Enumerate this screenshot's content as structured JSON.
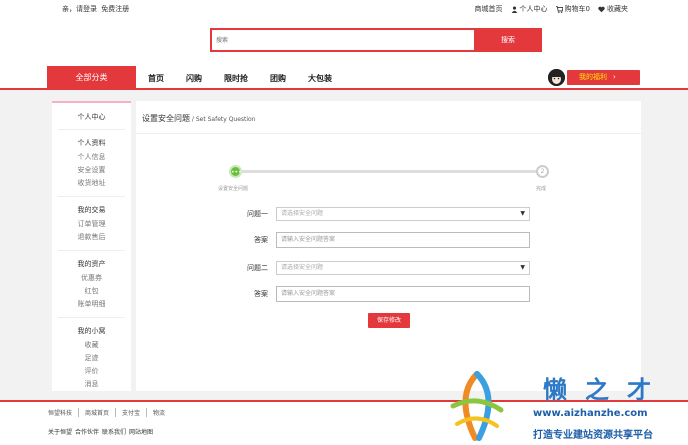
{
  "topbar": {
    "greeting": "亲，请登录",
    "register": "免费注册",
    "links": [
      {
        "label": "商城首页",
        "icon": ""
      },
      {
        "label": "个人中心",
        "icon": "user-icon"
      },
      {
        "label": "购物车0",
        "icon": "cart-icon"
      },
      {
        "label": "收藏夹",
        "icon": "heart-icon"
      }
    ]
  },
  "search": {
    "placeholder": "搜索",
    "button": "搜索"
  },
  "nav": {
    "all_category": "全部分类",
    "menu": [
      "首页",
      "闪购",
      "限时抢",
      "团购",
      "大包装"
    ],
    "welfare": "我的福利",
    "welfare_arrow": "›"
  },
  "sidebar": {
    "title": "个人中心",
    "groups": [
      {
        "header": "个人资料",
        "items": [
          "个人信息",
          "安全设置",
          "收货地址"
        ]
      },
      {
        "header": "我的交易",
        "items": [
          "订单管理",
          "退款售后"
        ]
      },
      {
        "header": "我的资产",
        "items": [
          "优惠券",
          "红包",
          "账单明细"
        ]
      },
      {
        "header": "我的小窝",
        "items": [
          "收藏",
          "足迹",
          "评价",
          "消息"
        ]
      }
    ]
  },
  "main": {
    "title": "设置安全问题",
    "title_en": " / Set Safety Question",
    "steps": [
      {
        "label": "设置安全问题",
        "marker": "•••"
      },
      {
        "label": "完成",
        "marker": "2"
      }
    ],
    "rows": [
      {
        "label": "问题一",
        "type": "select",
        "placeholder": "请选择安全问题"
      },
      {
        "label": "答案",
        "type": "input",
        "placeholder": "请输入安全问题答案"
      },
      {
        "label": "问题二",
        "type": "select",
        "placeholder": "请选择安全问题"
      },
      {
        "label": "答案",
        "type": "input",
        "placeholder": "请输入安全问题答案"
      }
    ],
    "save_button": "保存修改"
  },
  "footer": {
    "links": [
      "恒望科技",
      "商城首页",
      "支付宝",
      "物流"
    ],
    "sub": [
      "关于恒望",
      "合作伙伴",
      "联系我们",
      "网站地图"
    ]
  },
  "watermark": {
    "big": "懒之才",
    "url": "www.aizhanzhe.com",
    "slogan": "打造专业建站资源共享平台"
  },
  "colors": {
    "accent": "#e4393c",
    "welfare_text": "#ffe600",
    "step_active": "#6bbf3f"
  }
}
